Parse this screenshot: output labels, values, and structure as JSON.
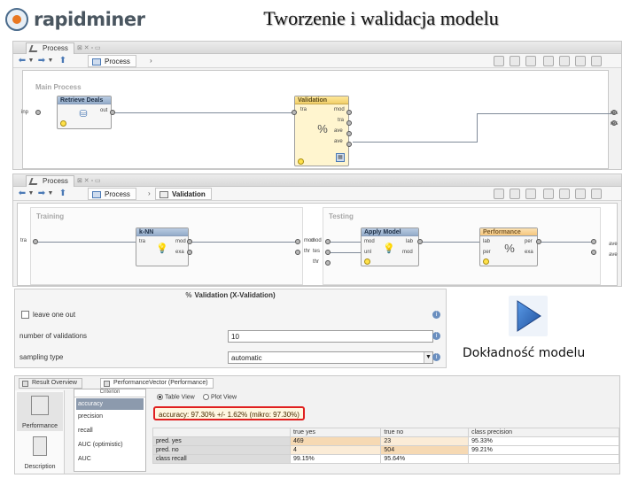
{
  "header": {
    "logo_text": "rapidminer",
    "title": "Tworzenie i walidacja modelu"
  },
  "panel1": {
    "tab_label": "Process",
    "breadcrumb": [
      "Process"
    ],
    "subprocess_label": "Main Process",
    "ops": {
      "retrieve": {
        "name": "Retrieve Deals",
        "ports": [
          "out"
        ]
      },
      "validation": {
        "name": "Validation",
        "in_ports": [
          "tra"
        ],
        "out_ports": [
          "mod",
          "tra",
          "ave",
          "ave"
        ]
      }
    },
    "left_port": "inp",
    "right_ports": [
      "res",
      "res"
    ]
  },
  "panel2": {
    "tab_label": "Process",
    "breadcrumb": [
      "Process",
      "Validation"
    ],
    "training_label": "Training",
    "testing_label": "Testing",
    "ops": {
      "knn": {
        "name": "k-NN",
        "in_ports": [
          "tra"
        ],
        "out_ports": [
          "mod",
          "exa"
        ]
      },
      "apply": {
        "name": "Apply Model",
        "in_ports": [
          "mod",
          "unl"
        ],
        "out_ports": [
          "lab",
          "mod"
        ]
      },
      "perf": {
        "name": "Performance",
        "in_ports": [
          "lab",
          "per"
        ],
        "out_ports": [
          "per",
          "exa"
        ]
      }
    },
    "train_in": "tra",
    "train_out": [
      "mod",
      "thr"
    ],
    "test_in": [
      "mod",
      "tes",
      "thr"
    ],
    "test_out": [
      "ave",
      "ave"
    ]
  },
  "params": {
    "title": "Validation (X-Validation)",
    "leave_one_out": "leave one out",
    "num_validations_label": "number of validations",
    "num_validations_value": "10",
    "sampling_label": "sampling type",
    "sampling_value": "automatic"
  },
  "play_label": "Dokładność modelu",
  "results": {
    "tabs": [
      "Result Overview",
      "PerformanceVector (Performance)"
    ],
    "side": [
      "Performance",
      "Description"
    ],
    "criterion_title": "Criterion",
    "criteria": [
      "accuracy",
      "precision",
      "recall",
      "AUC (optimistic)",
      "AUC"
    ],
    "view_table": "Table View",
    "view_plot": "Plot View",
    "accuracy_text": "accuracy: 97.30% +/- 1.62% (mikro: 97.30%)",
    "table": {
      "header": [
        "",
        "true yes",
        "true no",
        "class precision"
      ],
      "rows": [
        [
          "pred. yes",
          "469",
          "23",
          "95.33%"
        ],
        [
          "pred. no",
          "4",
          "504",
          "99.21%"
        ],
        [
          "class recall",
          "99.15%",
          "95.64%",
          ""
        ]
      ]
    }
  }
}
